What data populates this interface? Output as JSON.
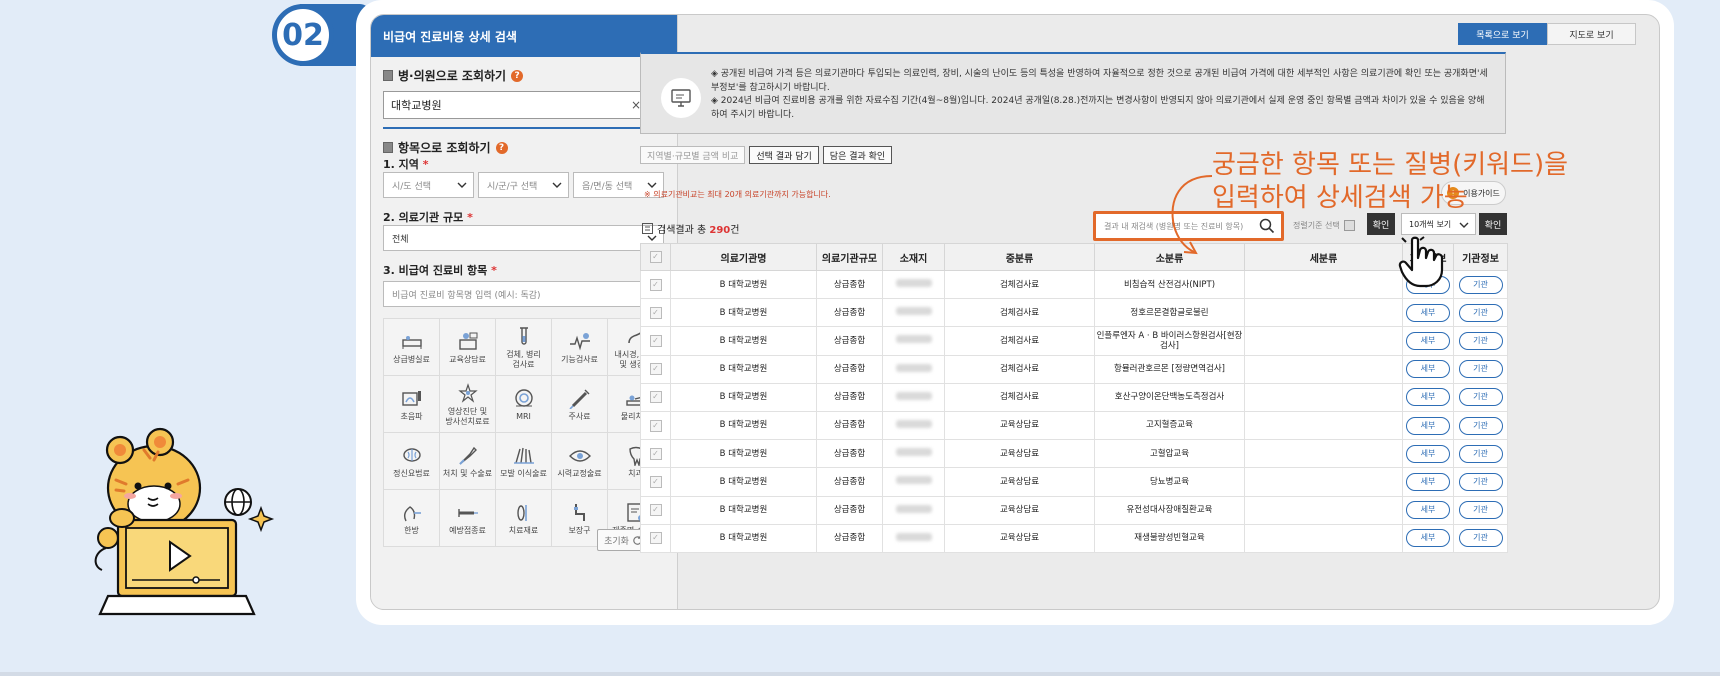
{
  "step_badge": "02",
  "left_panel": {
    "header": "비급여 진료비용 상세 검색",
    "hospital_section": {
      "title": "병·의원으로 조회하기",
      "input_value": "대학교병원",
      "clear": "×"
    },
    "item_section": {
      "title": "항목으로 조회하기"
    },
    "region_label": "1. 지역",
    "region_selects": [
      "시/도 선택",
      "시/군/구 선택",
      "읍/면/동 선택"
    ],
    "size_label": "2. 의료기관 규모",
    "size_select": "전체",
    "item_label": "3. 비급여 진료비 항목",
    "item_placeholder": "비급여 진료비 항목명 입력 (예시: 독감)",
    "required_mark": "*",
    "categories": [
      {
        "label": "상급병실료",
        "icon": "bed-icon"
      },
      {
        "label": "교육상담료",
        "icon": "consult-icon"
      },
      {
        "label": "검체, 병리\n검사료",
        "icon": "test-tube-icon"
      },
      {
        "label": "기능검사료",
        "icon": "function-test-icon"
      },
      {
        "label": "내시경, 천자\n및 생검료",
        "icon": "endoscope-icon"
      },
      {
        "label": "초음파",
        "icon": "ultrasound-icon"
      },
      {
        "label": "영상진단 및\n방사선치료료",
        "icon": "radiation-icon"
      },
      {
        "label": "MRI",
        "icon": "mri-icon"
      },
      {
        "label": "주사료",
        "icon": "syringe-icon"
      },
      {
        "label": "물리치료",
        "icon": "physio-icon"
      },
      {
        "label": "정신요법료",
        "icon": "brain-icon"
      },
      {
        "label": "처치 및 수술료",
        "icon": "scalpel-icon"
      },
      {
        "label": "모발 이식술료",
        "icon": "hair-icon"
      },
      {
        "label": "시력교정술료",
        "icon": "eye-icon"
      },
      {
        "label": "치과",
        "icon": "tooth-icon"
      },
      {
        "label": "한방",
        "icon": "herbal-icon"
      },
      {
        "label": "예방접종료",
        "icon": "vaccine-icon"
      },
      {
        "label": "치료재료",
        "icon": "material-icon"
      },
      {
        "label": "보장구",
        "icon": "orthosis-icon"
      },
      {
        "label": "제증명 수수료",
        "icon": "certificate-icon"
      }
    ],
    "reset": "초기화"
  },
  "view_tabs": {
    "list": "목록으로 보기",
    "map": "지도로 보기"
  },
  "notice": [
    "◈ 공개된 비급여 가격 등은 의료기관마다 투입되는 의료인력, 장비, 시술의 난이도 등의 특성을 반영하여 자율적으로 정한 것으로 공개된 비급여 가격에 대한 세부적인 사항은 의료기관에 확인 또는 공개화면'세부정보'를 참고하시기 바랍니다.",
    "◈ 2024년 비급여 진료비용 공개를 위한 자료수집 기간(4월~8월)입니다. 2024년 공개일(8.28.)전까지는 변경사항이 반영되지 않아 의료기관에서 실제 운영 중인 항목별 금액과 차이가 있을 수 있음을 양해하여 주시기 바랍니다."
  ],
  "toolbar": {
    "compare": "지역별·규모별 금액 비교",
    "save": "선택 결과 담기",
    "view_saved": "담은 결과 확인"
  },
  "warning": "※ 의료기관비교는 최대 20개 의료기관까지 가능합니다.",
  "guide": {
    "badge": "!",
    "label": "이용가이드"
  },
  "results": {
    "prefix": "검색결과 총 ",
    "count": "290",
    "suffix": "건"
  },
  "refine_placeholder": "결과 내 재검색 (병원명 또는 진료비 항목)",
  "sort_label": "정렬기준 선택",
  "confirm": "확인",
  "per_page": "10개씩 보기",
  "callout": "궁금한 항목 또는 질병(키워드)을\n입력하여 상세검색 가능",
  "table": {
    "headers": [
      "",
      "의료기관명",
      "의료기관규모",
      "소재지",
      "중분류",
      "소분류",
      "세분류",
      "가격정보",
      "기관정보"
    ],
    "price_btn": "세부",
    "inst_btn": "기관",
    "check_mark": "✓",
    "rows": [
      {
        "name": "B  대학교병원",
        "size": "상급종합",
        "mid": "검체검사료",
        "small": "비침습적 산전검사(NIPT)"
      },
      {
        "name": "B  대학교병원",
        "size": "상급종합",
        "mid": "검체검사료",
        "small": "정호르몬결합글로불린"
      },
      {
        "name": "B  대학교병원",
        "size": "상급종합",
        "mid": "검체검사료",
        "small": "인플루엔자 A · B 바이러스항원검사[현장\n검사]"
      },
      {
        "name": "B  대학교병원",
        "size": "상급종합",
        "mid": "검체검사료",
        "small": "항뮬러관호르몬 [정량면역검사]"
      },
      {
        "name": "B  대학교병원",
        "size": "상급종합",
        "mid": "검체검사료",
        "small": "호산구양이온단백농도측정검사"
      },
      {
        "name": "B  대학교병원",
        "size": "상급종합",
        "mid": "교육상담료",
        "small": "고지혈증교육"
      },
      {
        "name": "B  대학교병원",
        "size": "상급종합",
        "mid": "교육상담료",
        "small": "고혈압교육"
      },
      {
        "name": "B  대학교병원",
        "size": "상급종합",
        "mid": "교육상담료",
        "small": "당뇨병교육"
      },
      {
        "name": "B  대학교병원",
        "size": "상급종합",
        "mid": "교육상담료",
        "small": "유전성대사장애질환교육"
      },
      {
        "name": "B  대학교병원",
        "size": "상급종합",
        "mid": "교육상담료",
        "small": "재생불량성빈혈교육"
      }
    ]
  },
  "colors": {
    "brand_blue": "#2d6db5",
    "accent_orange": "#e2692a"
  }
}
